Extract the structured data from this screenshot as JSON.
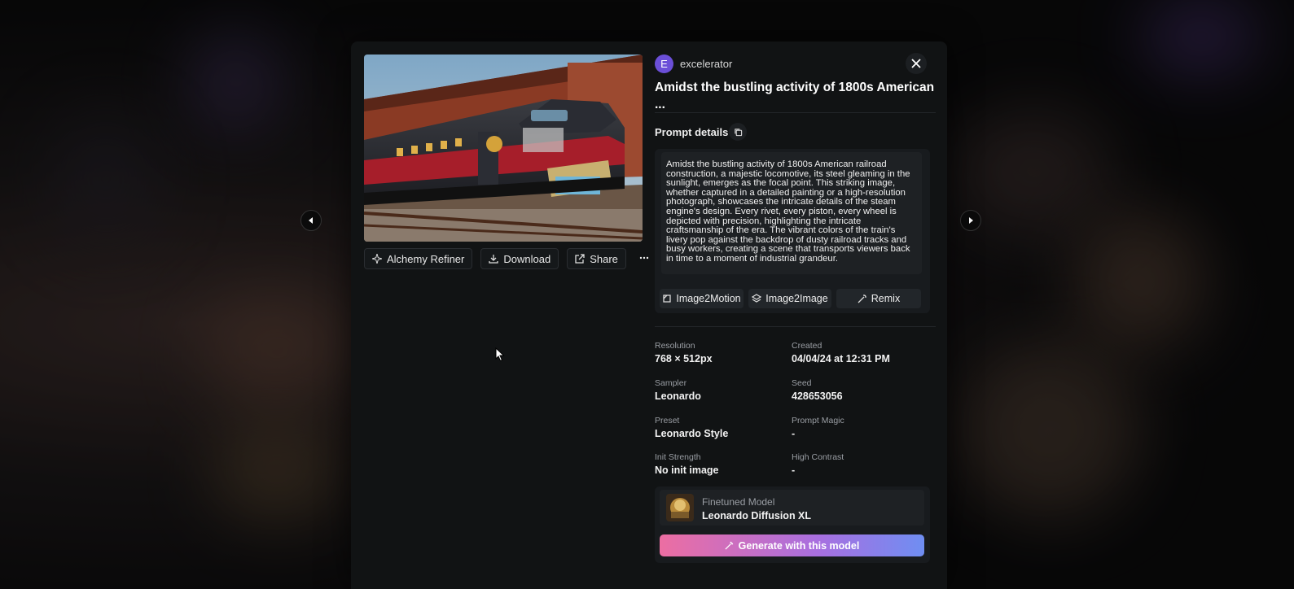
{
  "author": {
    "initial": "E",
    "name": "excelerator"
  },
  "title": "Amidst the bustling activity of 1800s American ...",
  "image_actions": {
    "alchemy_refiner": "Alchemy Refiner",
    "download": "Download",
    "share": "Share"
  },
  "prompt": {
    "label": "Prompt details",
    "text": "Amidst the bustling activity of 1800s American railroad construction, a majestic locomotive, its steel gleaming in the sunlight, emerges as the focal point. This striking image, whether captured in a detailed painting or a high-resolution photograph, showcases the intricate details of the steam engine's design. Every rivet, every piston, every wheel is depicted with precision, highlighting the intricate craftsmanship of the era. The vibrant colors of the train's livery pop against the backdrop of dusty railroad tracks and busy workers, creating a scene that transports viewers back in time to a moment of industrial grandeur.",
    "actions": {
      "image2motion": "Image2Motion",
      "image2image": "Image2Image",
      "remix": "Remix"
    }
  },
  "meta": {
    "resolution_label": "Resolution",
    "resolution_value": "768 × 512px",
    "created_label": "Created",
    "created_value": "04/04/24 at 12:31 PM",
    "sampler_label": "Sampler",
    "sampler_value": "Leonardo",
    "seed_label": "Seed",
    "seed_value": "428653056",
    "preset_label": "Preset",
    "preset_value": "Leonardo Style",
    "prompt_magic_label": "Prompt Magic",
    "prompt_magic_value": "-",
    "init_strength_label": "Init Strength",
    "init_strength_value": "No init image",
    "high_contrast_label": "High Contrast",
    "high_contrast_value": "-"
  },
  "model": {
    "label": "Finetuned Model",
    "name": "Leonardo Diffusion XL",
    "generate_label": "Generate with this model"
  },
  "colors": {
    "accent_avatar": "#6b4fd8",
    "gradient_start": "#ec6ea2",
    "gradient_end": "#6f8ef2"
  }
}
